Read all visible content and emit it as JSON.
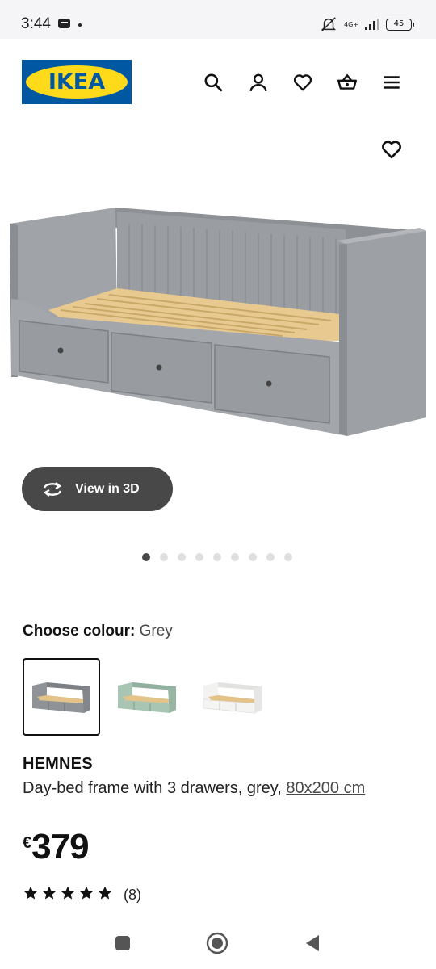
{
  "status_bar": {
    "time": "3:44",
    "network": "4G+",
    "battery": "45",
    "icons": [
      "message-icon",
      "mute-icon",
      "signal-icon",
      "battery-icon"
    ]
  },
  "header": {
    "logo_text": "IKEA",
    "icons": [
      "search-icon",
      "account-icon",
      "favourites-icon",
      "basket-icon",
      "menu-icon"
    ]
  },
  "gallery": {
    "view_3d_label": "View in 3D",
    "image_count": 9,
    "active_index": 0
  },
  "colour": {
    "label": "Choose colour:",
    "value": "Grey",
    "options": [
      {
        "name": "grey",
        "color": "#8f9297",
        "selected": true
      },
      {
        "name": "green",
        "color": "#a8c4b3",
        "selected": false
      },
      {
        "name": "white",
        "color": "#f2f2f0",
        "selected": false
      }
    ]
  },
  "product": {
    "brand": "HEMNES",
    "description": "Day-bed frame with 3 drawers, grey, ",
    "size": "80x200 cm",
    "currency": "€",
    "price": "379",
    "rating_stars": 5,
    "review_count": "(8)"
  },
  "colors": {
    "ikea_blue": "#0058a3",
    "ikea_yellow": "#ffda1a",
    "button_dark": "#484848"
  }
}
